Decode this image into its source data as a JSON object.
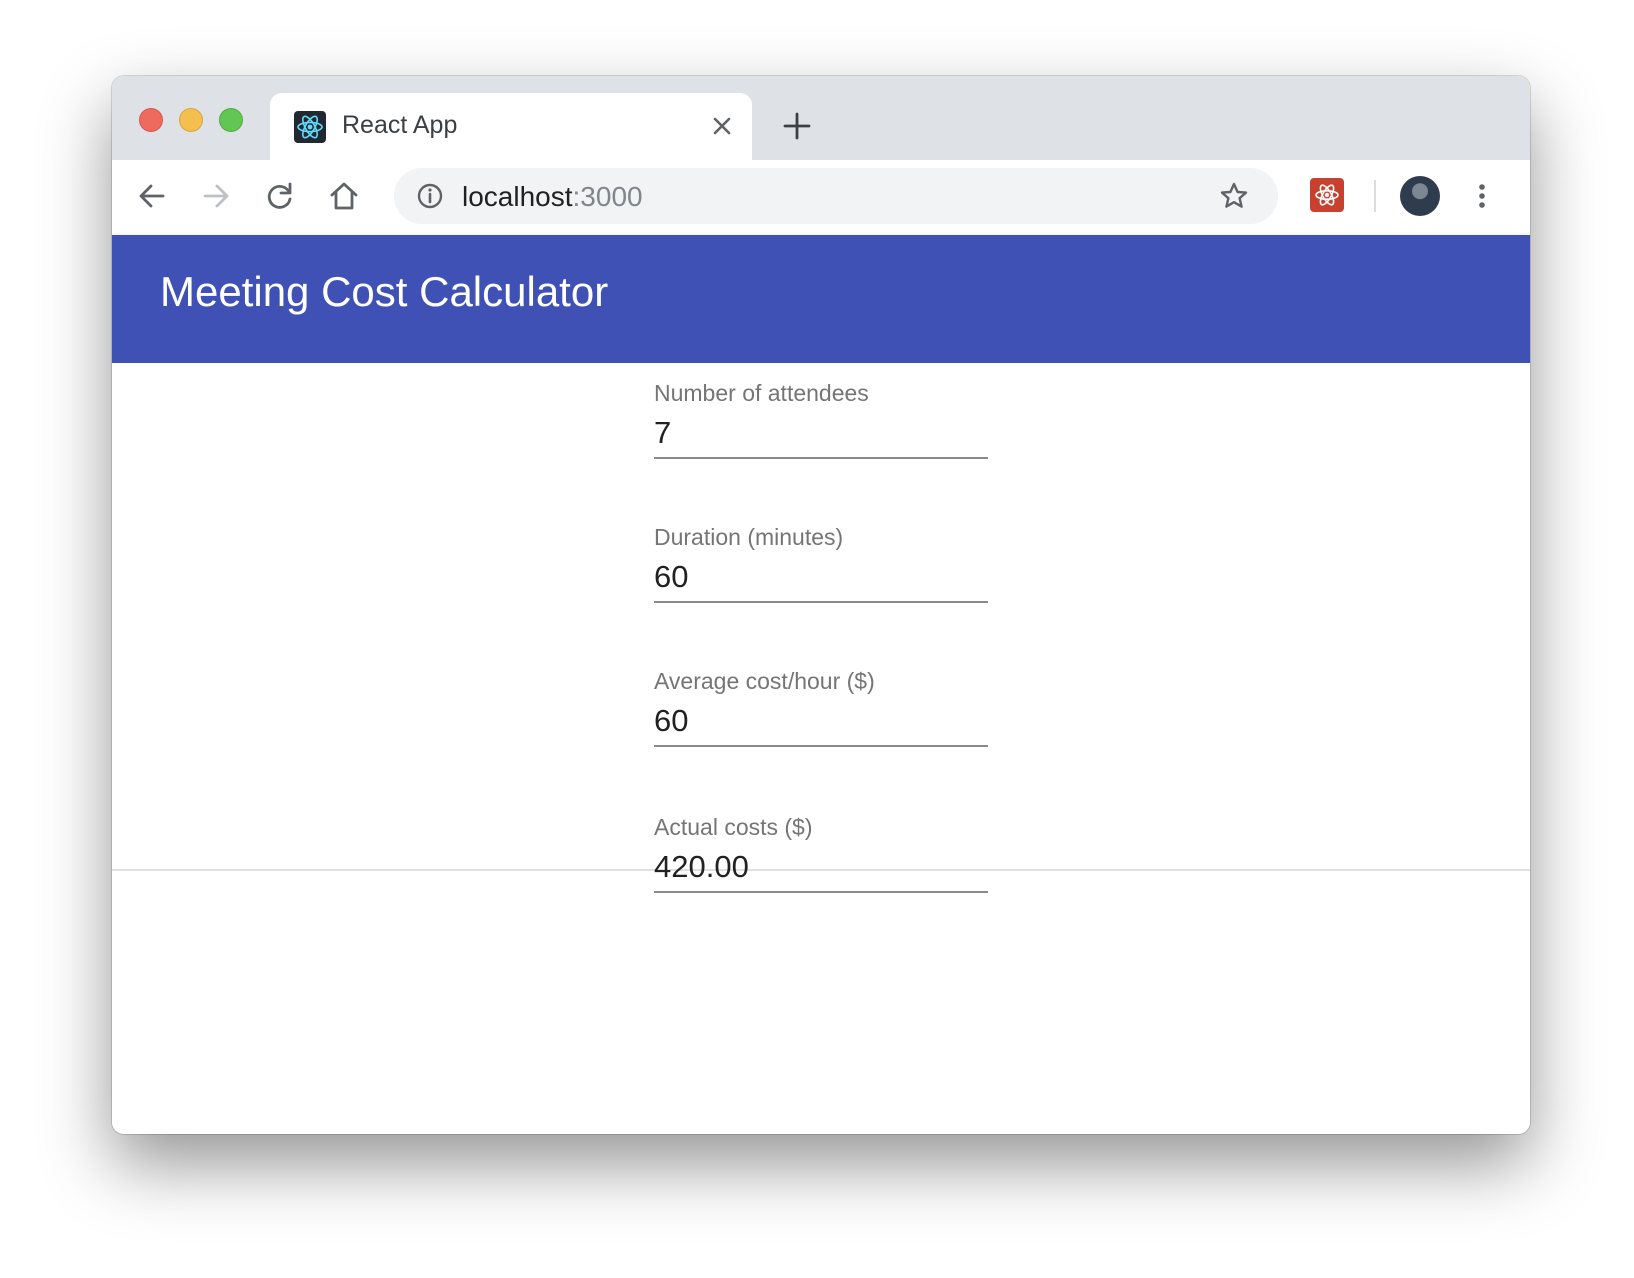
{
  "browser": {
    "tab": {
      "title": "React App",
      "icon": "react-logo-icon",
      "close_icon": "close-icon"
    },
    "new_tab_icon": "plus-icon",
    "toolbar": {
      "back_icon": "back-arrow-icon",
      "forward_icon": "forward-arrow-icon",
      "reload_icon": "reload-icon",
      "home_icon": "home-icon",
      "site_info_icon": "info-icon",
      "url_host": "localhost",
      "url_port": ":3000",
      "bookmark_icon": "star-icon",
      "extension_icon": "react-devtools-icon",
      "profile_icon": "profile-avatar",
      "menu_icon": "more-vertical-icon"
    }
  },
  "app": {
    "title": "Meeting Cost Calculator",
    "accent_color": "#3f51b5",
    "fields": [
      {
        "label": "Number of attendees",
        "value": "7"
      },
      {
        "label": "Duration (minutes)",
        "value": "60"
      },
      {
        "label": "Average cost/hour ($)",
        "value": "60"
      }
    ],
    "result": {
      "label": "Actual costs ($)",
      "value": "420.00"
    }
  }
}
